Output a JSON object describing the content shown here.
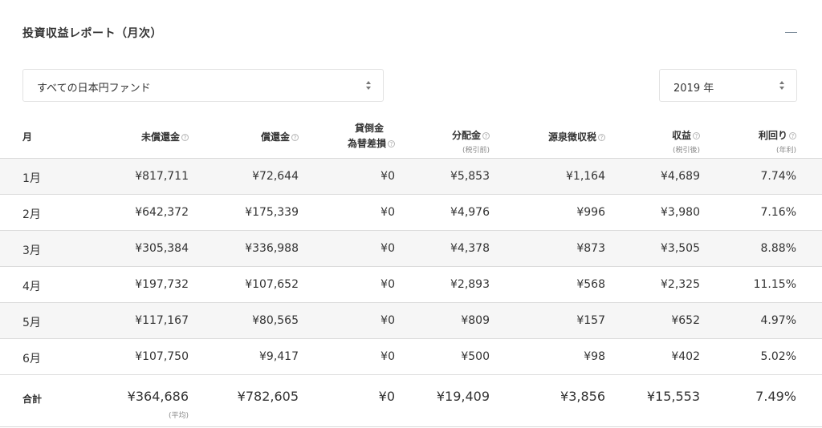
{
  "header": {
    "title": "投資収益レポート（月次）"
  },
  "filters": {
    "fund": "すべての日本円ファンド",
    "year": "2019 年"
  },
  "columns": {
    "month": "月",
    "unredeemed": "未償還金",
    "redemption": "償還金",
    "loss_line1": "貸倒金",
    "loss_line2": "為替差損",
    "distribution": "分配金",
    "distribution_sub": "(税引前)",
    "withholding_tax": "源泉徴収税",
    "income": "収益",
    "income_sub": "(税引後)",
    "yield": "利回り",
    "yield_sub": "(年利)",
    "help_glyph": "?"
  },
  "rows": [
    {
      "month": "1月",
      "unredeemed": "¥817,711",
      "redemption": "¥72,644",
      "loss": "¥0",
      "distribution": "¥5,853",
      "tax": "¥1,164",
      "income": "¥4,689",
      "yield": "7.74%"
    },
    {
      "month": "2月",
      "unredeemed": "¥642,372",
      "redemption": "¥175,339",
      "loss": "¥0",
      "distribution": "¥4,976",
      "tax": "¥996",
      "income": "¥3,980",
      "yield": "7.16%"
    },
    {
      "month": "3月",
      "unredeemed": "¥305,384",
      "redemption": "¥336,988",
      "loss": "¥0",
      "distribution": "¥4,378",
      "tax": "¥873",
      "income": "¥3,505",
      "yield": "8.88%"
    },
    {
      "month": "4月",
      "unredeemed": "¥197,732",
      "redemption": "¥107,652",
      "loss": "¥0",
      "distribution": "¥2,893",
      "tax": "¥568",
      "income": "¥2,325",
      "yield": "11.15%"
    },
    {
      "month": "5月",
      "unredeemed": "¥117,167",
      "redemption": "¥80,565",
      "loss": "¥0",
      "distribution": "¥809",
      "tax": "¥157",
      "income": "¥652",
      "yield": "4.97%"
    },
    {
      "month": "6月",
      "unredeemed": "¥107,750",
      "redemption": "¥9,417",
      "loss": "¥0",
      "distribution": "¥500",
      "tax": "¥98",
      "income": "¥402",
      "yield": "5.02%"
    }
  ],
  "total": {
    "label": "合計",
    "unredeemed": "¥364,686",
    "unredeemed_sub": "(平均)",
    "redemption": "¥782,605",
    "loss": "¥0",
    "distribution": "¥19,409",
    "tax": "¥3,856",
    "income": "¥15,553",
    "yield": "7.49%"
  }
}
